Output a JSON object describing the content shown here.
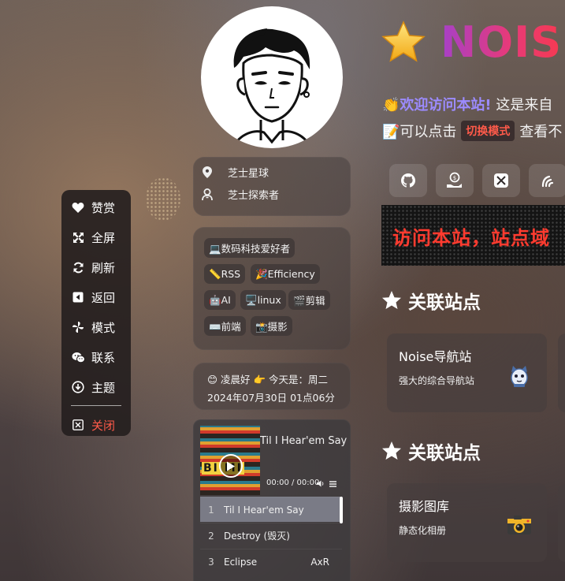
{
  "menu": {
    "items": [
      {
        "label": "赞赏",
        "icon": "heart-icon"
      },
      {
        "label": "全屏",
        "icon": "fullscreen-icon"
      },
      {
        "label": "刷新",
        "icon": "refresh-icon"
      },
      {
        "label": "返回",
        "icon": "back-icon"
      },
      {
        "label": "模式",
        "icon": "pinwheel-icon"
      },
      {
        "label": "联系",
        "icon": "wechat-icon"
      },
      {
        "label": "主题",
        "icon": "download-circle-icon"
      }
    ],
    "close_label": "关闭"
  },
  "profile": {
    "location": "芝士星球",
    "role": "芝士探索者"
  },
  "tags": [
    "💻数码科技爱好者",
    "📏RSS",
    "🎉Efficiency",
    "🤖AI",
    "🖥️linux",
    "🎬剪辑",
    "⌨️前端",
    "📸摄影"
  ],
  "greeting": {
    "line1": "😊 凌晨好 👉 今天是：周二",
    "line2": "2024年07月30日 01点06分"
  },
  "player": {
    "cover_text": "BI  MI",
    "now_playing": "Til I Hear'em Say",
    "time": "00:00 / 00:00",
    "playlist": [
      {
        "num": "1",
        "name": "Til I Hear'em Say",
        "artist": ""
      },
      {
        "num": "2",
        "name": "Destroy (毁灭)",
        "artist": ""
      },
      {
        "num": "3",
        "name": "Eclipse",
        "artist": "AxR"
      }
    ]
  },
  "header": {
    "title": "NOISE",
    "welcome_highlight": "👏欢迎访问本站!",
    "welcome_rest": " 这是来自",
    "hint_prefix": "📝可以点击",
    "hint_badge": "切换模式",
    "hint_suffix": "查看不"
  },
  "social": [
    "github-icon",
    "donate-icon",
    "x-icon",
    "bilibili-icon"
  ],
  "marquee": "访问本站，站点域",
  "sections": [
    {
      "title": "关联站点",
      "card": {
        "title": "Noise导航站",
        "desc": "强大的综合导航站",
        "icon": "mascot-icon"
      }
    },
    {
      "title": "关联站点",
      "card": {
        "title": "摄影图库",
        "desc": "静态化相册",
        "icon": "camera-icon"
      }
    }
  ],
  "colors": {
    "accent_red": "#ff3b2f",
    "highlight_purple": "#9c8bff",
    "menu_bg": "#231e1e"
  }
}
